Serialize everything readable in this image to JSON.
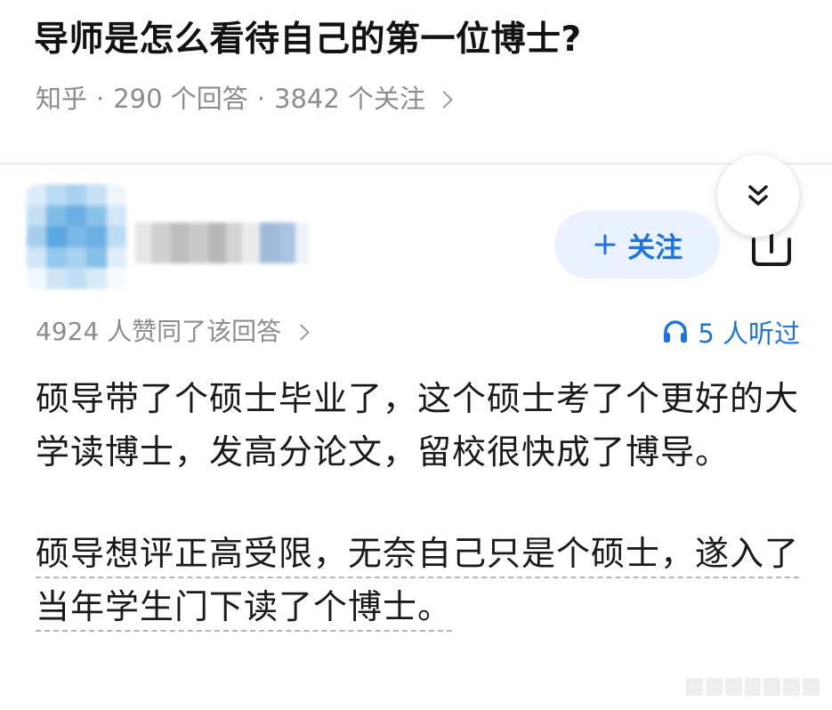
{
  "question": {
    "title": "导师是怎么看待自己的第一位博士?",
    "source": "知乎",
    "answers_count": "290 个回答",
    "followers_count": "3842 个关注",
    "separator": "·"
  },
  "answer_header": {
    "follow_label": "关注",
    "follow_plus": "+",
    "votes_text": "4924 人赞同了该回答",
    "listen_count": "5 人听过"
  },
  "answer": {
    "paragraphs": [
      "硕导带了个硕士毕业了，这个硕士考了个更好的大学读博士，发高分论文，留校很快成了博导。",
      "硕导想评正高受限，无奈自己只是个硕士，遂入了当年学生门下读了个博士。"
    ]
  },
  "icons": {
    "collapse": "double-chevron-down-icon",
    "share": "share-icon",
    "headphones": "headphones-icon",
    "arrow": "chevron-right-icon"
  },
  "colors": {
    "accent": "#1a73e8",
    "follow_bg": "#e9f2fe",
    "muted_text": "#8c8c8c",
    "title_text": "#121212"
  }
}
